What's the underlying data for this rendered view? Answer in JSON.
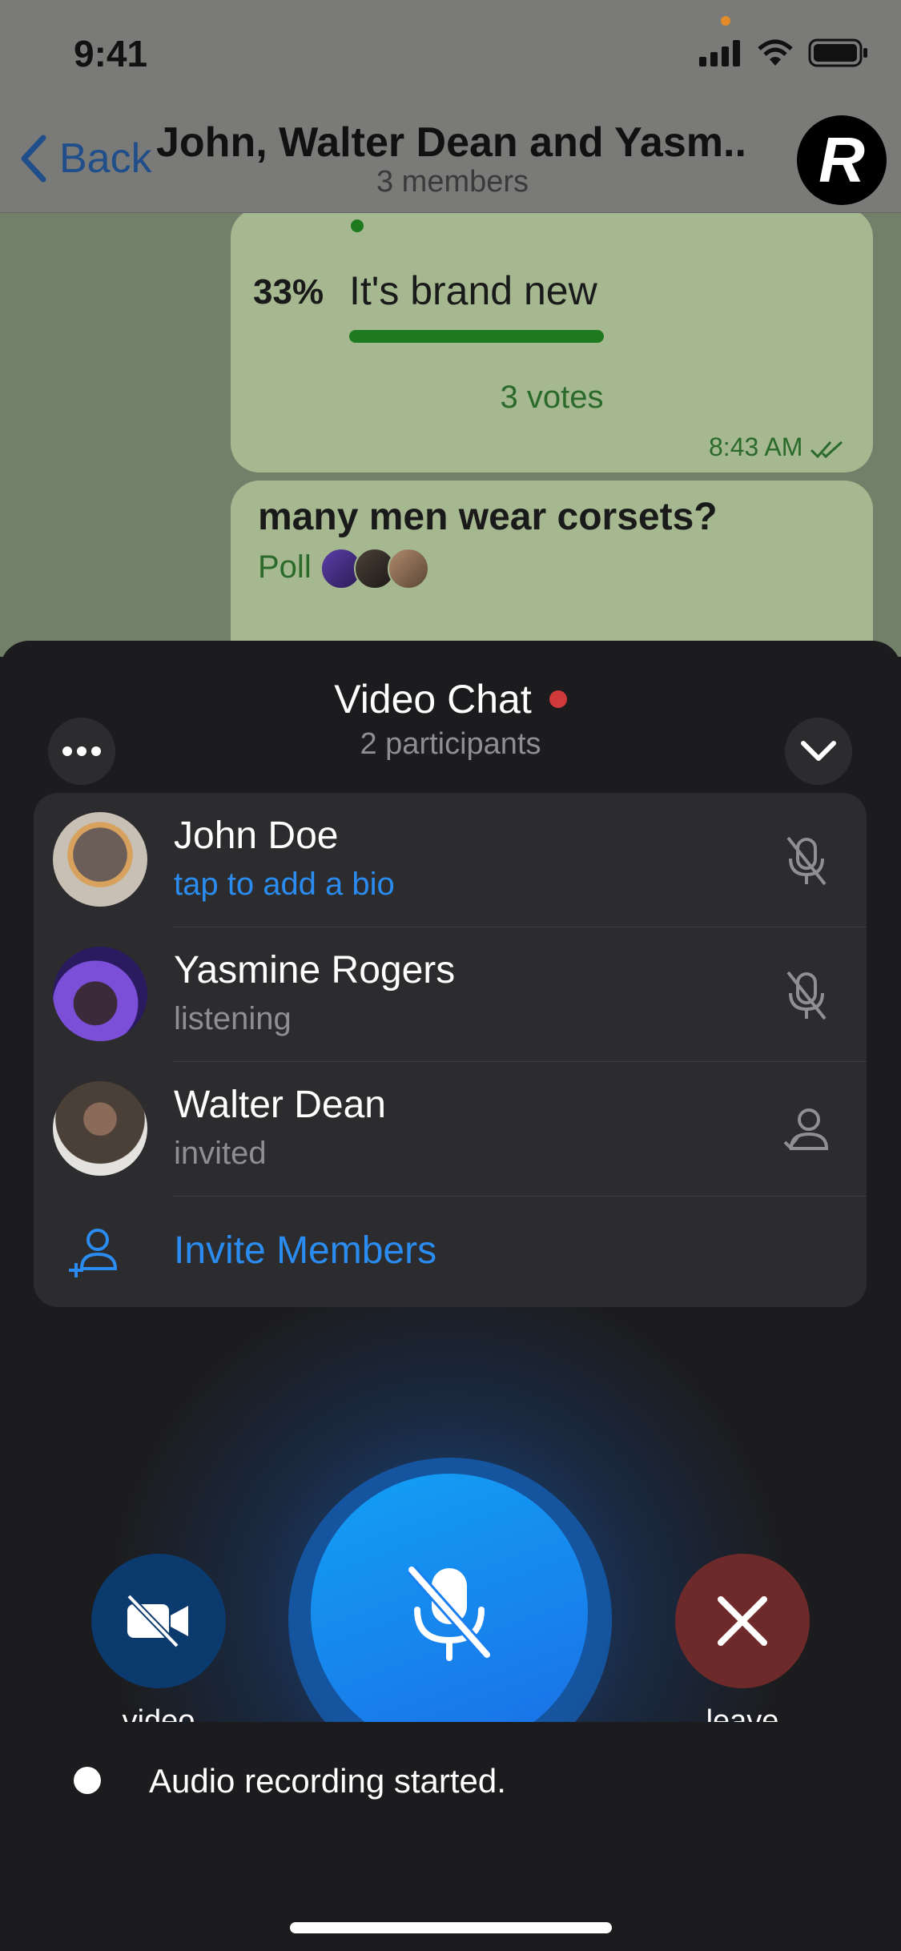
{
  "status_bar": {
    "time": "9:41"
  },
  "navbar": {
    "back_label": "Back",
    "title": "John, Walter Dean and Yasm...",
    "subtitle": "3 members",
    "avatar_letter": "R"
  },
  "chat": {
    "poll1": {
      "percent": "33%",
      "option": "It's brand new",
      "votes": "3 votes",
      "time": "8:43 AM",
      "fill": 0.33
    },
    "poll2": {
      "question": "many men wear corsets?",
      "label": "Poll"
    }
  },
  "sheet": {
    "title": "Video Chat",
    "subtitle": "2 participants",
    "participants": [
      {
        "name": "John Doe",
        "status": "tap to add a bio",
        "icon": "mic-off-icon"
      },
      {
        "name": "Yasmine Rogers",
        "status": "listening",
        "icon": "mic-off-icon"
      },
      {
        "name": "Walter Dean",
        "status": "invited",
        "icon": "invited-user-icon"
      }
    ],
    "invite_label": "Invite Members",
    "video_label": "video",
    "leave_label": "leave"
  },
  "toast": {
    "text": "Audio recording started."
  },
  "colors": {
    "accent": "#2a8cf0",
    "record": "#d13a3a",
    "mic_button": "#1b6fe6",
    "leave_button": "#6e2a2a",
    "video_button": "#0b3a6e"
  }
}
